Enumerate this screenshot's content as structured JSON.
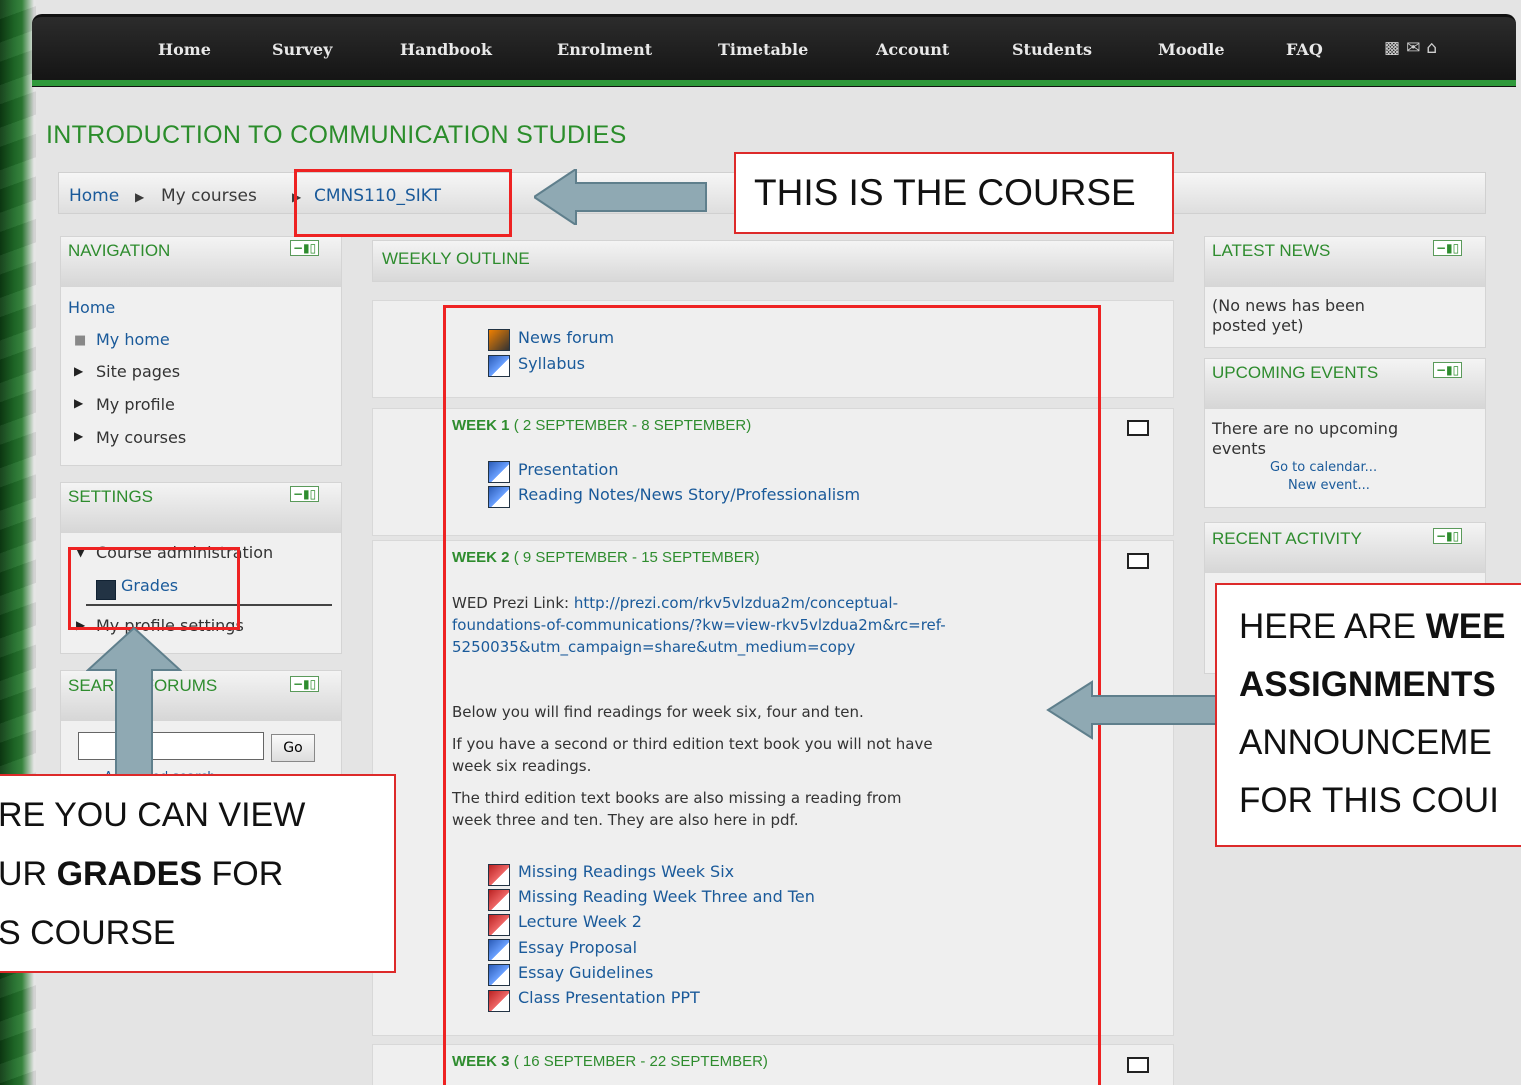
{
  "nav": {
    "items": [
      "Home",
      "Survey",
      "Handbook",
      "Enrolment",
      "Timetable",
      "Account",
      "Students",
      "Moodle",
      "FAQ"
    ],
    "icons": [
      "print-icon",
      "mail-icon",
      "home-icon"
    ]
  },
  "course_title": "INTRODUCTION TO COMMUNICATION STUDIES",
  "breadcrumb": {
    "home": "Home",
    "sep": "▶",
    "my_courses": "My courses",
    "course": "CMNS110_SIKT"
  },
  "navigation_block": {
    "title": "NAVIGATION",
    "items": [
      "Home",
      "My home",
      "Site pages",
      "My profile",
      "My courses"
    ]
  },
  "settings_block": {
    "title": "SETTINGS",
    "items": [
      "Course administration",
      "Grades",
      "My profile settings"
    ]
  },
  "search_block": {
    "title": "SEARCH FORUMS",
    "button": "Go",
    "advanced": "Advanced search"
  },
  "weekly_outline": {
    "title": "WEEKLY OUTLINE",
    "top_items": [
      "News forum",
      "Syllabus"
    ],
    "week1": {
      "label": "WEEK 1",
      "dates": "( 2 SEPTEMBER - 8 SEPTEMBER)",
      "items": [
        "Presentation",
        "Reading Notes/News Story/Professionalism"
      ]
    },
    "week2": {
      "label": "WEEK 2",
      "dates": "( 9 SEPTEMBER - 15 SEPTEMBER)",
      "prezi_label": "WED Prezi Link: ",
      "prezi_url_l1": "http://prezi.com/rkv5vlzdua2m/conceptual-",
      "prezi_url_l2": "foundations-of-communications/?kw=view-rkv5vlzdua2m&rc=ref-",
      "prezi_url_l3": "5250035&utm_campaign=share&utm_medium=copy",
      "para1": "Below you will find readings for week six, four and ten.",
      "para2_l1": "If you have a second or third edition text book you will not have",
      "para2_l2": "week six readings.",
      "para3_l1": "The third edition text books are also missing a reading from",
      "para3_l2": "week three and ten. They are also here in pdf.",
      "items": [
        "Missing Readings Week Six",
        "Missing Reading Week Three and Ten",
        "Lecture Week 2",
        "Essay Proposal",
        "Essay Guidelines",
        "Class Presentation PPT"
      ]
    },
    "week3": {
      "label": "WEEK 3",
      "dates": "( 16 SEPTEMBER - 22 SEPTEMBER)"
    }
  },
  "latest_news": {
    "title": "LATEST NEWS",
    "line1": "(No news has been",
    "line2": "posted yet)"
  },
  "upcoming_events": {
    "title": "UPCOMING EVENTS",
    "line1": "There are no upcoming",
    "line2": "events",
    "calendar": "Go to calendar...",
    "new_event": "New event..."
  },
  "recent_activity": {
    "title": "RECENT ACTIVITY"
  },
  "callouts": {
    "course": "THIS IS THE COURSE",
    "grades_l1": "RE YOU CAN VIEW",
    "grades_l2a": "UR ",
    "grades_l2b": "GRADES",
    "grades_l2c": " FOR",
    "grades_l3": "S COURSE",
    "weekly_l1a": "HERE ARE ",
    "weekly_l1b": "WEE",
    "weekly_l2": "ASSIGNMENTS",
    "weekly_l3": "ANNOUNCEME",
    "weekly_l4": "FOR THIS COUI"
  },
  "colors": {
    "accent_green": "#2e8c2e",
    "callout_red": "#dd2a2a",
    "arrow": "#8fa9b3"
  }
}
